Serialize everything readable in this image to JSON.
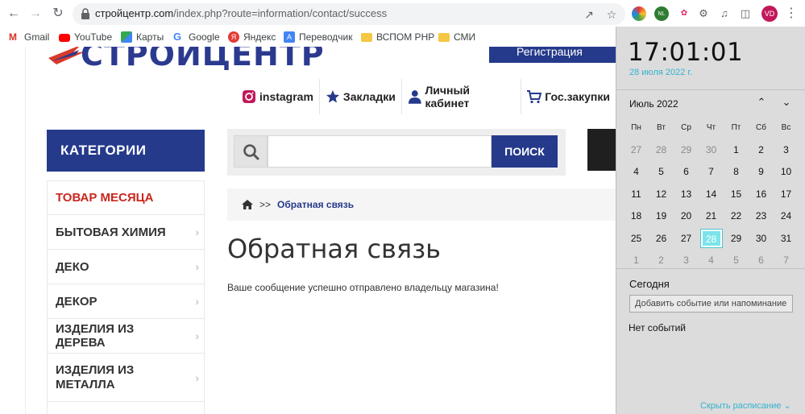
{
  "browser": {
    "url_host": "стройцентр.com",
    "url_path": "/index.php?route=information/contact/success",
    "avatar_initials": "VD",
    "ext_badge": "NL",
    "bookmarks": [
      {
        "label": "Gmail",
        "icon": "gmail-icon",
        "color": "#d93025"
      },
      {
        "label": "YouTube",
        "icon": "youtube-icon",
        "color": "#ff0000"
      },
      {
        "label": "Карты",
        "icon": "maps-icon",
        "color": "#34a853"
      },
      {
        "label": "Google",
        "icon": "google-icon",
        "color": "#4285f4"
      },
      {
        "label": "Яндекс",
        "icon": "yandex-icon",
        "color": "#e53935"
      },
      {
        "label": "Переводчик",
        "icon": "translate-icon",
        "color": "#4285f4"
      },
      {
        "label": "ВСПОМ PHP",
        "icon": "folder-icon",
        "color": "#f6c744"
      },
      {
        "label": "СМИ",
        "icon": "folder-icon",
        "color": "#f6c744"
      }
    ]
  },
  "site": {
    "logo_text": "СТРОЙЦЕНТР",
    "register_label": "Регистрация",
    "topnav": [
      {
        "label": "instagram",
        "icon": "instagram-icon"
      },
      {
        "label": "Закладки",
        "icon": "star-icon"
      },
      {
        "label": "Личный кабинет",
        "icon": "user-icon"
      },
      {
        "label": "Гос.закупки",
        "icon": "cart-icon"
      }
    ],
    "categories_title": "КАТЕГОРИИ",
    "categories": [
      {
        "label": "ТОВАР МЕСЯЦА",
        "hot": true
      },
      {
        "label": "БЫТОВАЯ ХИМИЯ",
        "hot": false
      },
      {
        "label": "ДЕКО",
        "hot": false
      },
      {
        "label": "ДЕКОР",
        "hot": false
      },
      {
        "label": "ИЗДЕЛИЯ ИЗ ДЕРЕВА",
        "hot": false
      },
      {
        "label": "ИЗДЕЛИЯ ИЗ МЕТАЛЛА",
        "hot": false
      }
    ],
    "search": {
      "placeholder": "",
      "button_label": "ПОИСК"
    },
    "breadcrumb": {
      "separator": ">>",
      "current": "Обратная связь"
    },
    "heading": "Обратная связь",
    "message": "Ваше сообщение успешно отправлено владельцу магазина!",
    "brand_color": "#253a8b",
    "hot_color": "#c9271e"
  },
  "calendar": {
    "time": "17:01:01",
    "date": "28 июля 2022 г.",
    "month_label": "Июль 2022",
    "weekdays": [
      "Пн",
      "Вт",
      "Ср",
      "Чт",
      "Пт",
      "Сб",
      "Вс"
    ],
    "weeks": [
      [
        {
          "d": "27",
          "o": true
        },
        {
          "d": "28",
          "o": true
        },
        {
          "d": "29",
          "o": true
        },
        {
          "d": "30",
          "o": true
        },
        {
          "d": "1"
        },
        {
          "d": "2"
        },
        {
          "d": "3"
        }
      ],
      [
        {
          "d": "4"
        },
        {
          "d": "5"
        },
        {
          "d": "6"
        },
        {
          "d": "7"
        },
        {
          "d": "8"
        },
        {
          "d": "9"
        },
        {
          "d": "10"
        }
      ],
      [
        {
          "d": "11"
        },
        {
          "d": "12"
        },
        {
          "d": "13"
        },
        {
          "d": "14"
        },
        {
          "d": "15"
        },
        {
          "d": "16"
        },
        {
          "d": "17"
        }
      ],
      [
        {
          "d": "18"
        },
        {
          "d": "19"
        },
        {
          "d": "20"
        },
        {
          "d": "21"
        },
        {
          "d": "22"
        },
        {
          "d": "23"
        },
        {
          "d": "24"
        }
      ],
      [
        {
          "d": "25"
        },
        {
          "d": "26"
        },
        {
          "d": "27"
        },
        {
          "d": "28",
          "today": true
        },
        {
          "d": "29"
        },
        {
          "d": "30"
        },
        {
          "d": "31"
        }
      ],
      [
        {
          "d": "1",
          "o": true
        },
        {
          "d": "2",
          "o": true
        },
        {
          "d": "3",
          "o": true
        },
        {
          "d": "4",
          "o": true
        },
        {
          "d": "5",
          "o": true
        },
        {
          "d": "6",
          "o": true
        },
        {
          "d": "7",
          "o": true
        }
      ]
    ],
    "today_label": "Сегодня",
    "add_event_label": "Добавить событие или напоминание",
    "no_events_label": "Нет событий",
    "hide_schedule_label": "Скрыть расписание",
    "accent_color": "#34b3cd"
  }
}
